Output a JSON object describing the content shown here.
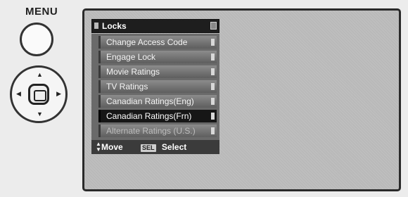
{
  "remote": {
    "menu_label": "MENU"
  },
  "osd": {
    "title": "Locks",
    "items": [
      {
        "label": "Change Access Code"
      },
      {
        "label": "Engage Lock"
      },
      {
        "label": "Movie Ratings"
      },
      {
        "label": "TV Ratings"
      },
      {
        "label": "Canadian Ratings(Eng)"
      },
      {
        "label": "Canadian Ratings(Frn)",
        "selected": true
      },
      {
        "label": "Alternate Ratings (U.S.)"
      }
    ],
    "footer": {
      "move_label": "Move",
      "sel_key": "SEL",
      "select_label": "Select"
    }
  }
}
